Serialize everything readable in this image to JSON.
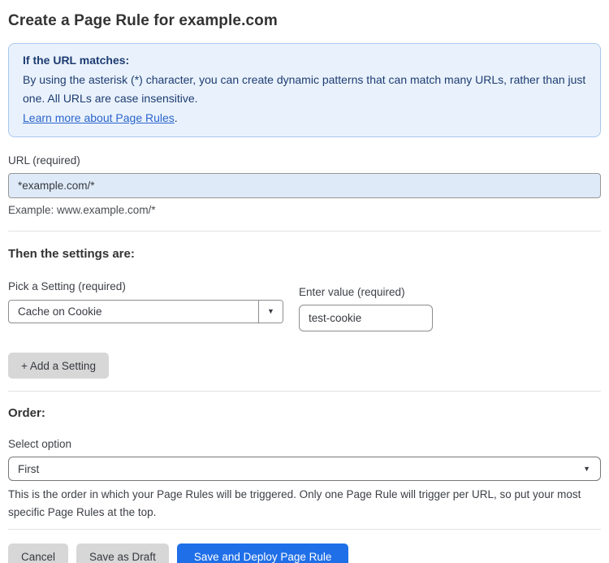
{
  "header": {
    "title": "Create a Page Rule for example.com"
  },
  "info_box": {
    "heading": "If the URL matches:",
    "body": "By using the asterisk (*) character, you can create dynamic patterns that can match many URLs, rather than just one. All URLs are case insensitive.",
    "link_text": "Learn more about Page Rules",
    "link_suffix": "."
  },
  "url_field": {
    "label": "URL (required)",
    "value": "*example.com/*",
    "helper": "Example: www.example.com/*"
  },
  "settings_section": {
    "heading": "Then the settings are:",
    "setting_label": "Pick a Setting (required)",
    "setting_selected": "Cache on Cookie",
    "value_label": "Enter value (required)",
    "value": "test-cookie",
    "add_button_label": "+ Add a Setting"
  },
  "order_section": {
    "heading": "Order:",
    "select_label": "Select option",
    "selected_option": "First",
    "description": "This is the order in which your Page Rules will be triggered. Only one Page Rule will trigger per URL, so put your most specific Page Rules at the top."
  },
  "footer": {
    "cancel_label": "Cancel",
    "save_draft_label": "Save as Draft",
    "save_deploy_label": "Save and Deploy Page Rule"
  },
  "icons": {
    "caret_down": "▼"
  },
  "colors": {
    "primary_button_blue": "#1f6fe8",
    "info_box_background": "#e9f2fc",
    "info_box_border": "#a8c8ed",
    "info_box_text": "#1e3c72",
    "link_blue": "#2b64cd",
    "url_input_background": "#dfeaf9",
    "gray_button_background": "#d7d7d7"
  }
}
